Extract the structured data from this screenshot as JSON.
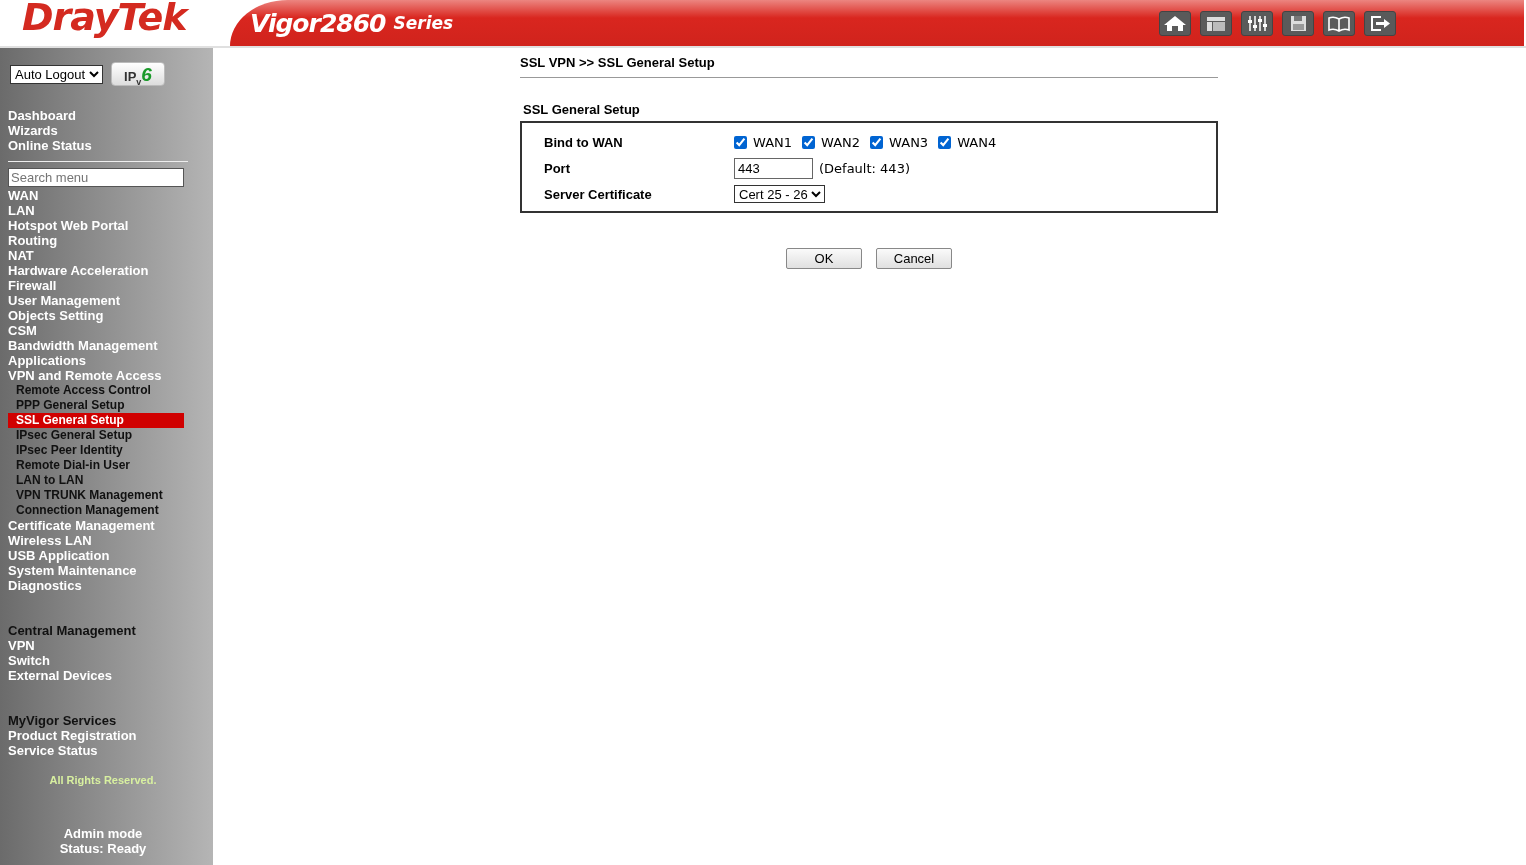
{
  "header": {
    "brand": "DrayTek",
    "model": "Vigor2860",
    "series": "Series"
  },
  "sidebar": {
    "auto_logout": {
      "value": "Auto Logout"
    },
    "ipv6_button": {
      "label": "IP$_{v}$**6**"
    },
    "top_links": [
      "Dashboard",
      "Wizards",
      "Online Status"
    ],
    "search": {
      "placeholder": "Search menu"
    },
    "menu": [
      {
        "label": "WAN"
      },
      {
        "label": "LAN"
      },
      {
        "label": "Hotspot Web Portal"
      },
      {
        "label": "Routing"
      },
      {
        "label": "NAT"
      },
      {
        "label": "Hardware Acceleration"
      },
      {
        "label": "Firewall"
      },
      {
        "label": "User Management"
      },
      {
        "label": "Objects Setting"
      },
      {
        "label": "CSM"
      },
      {
        "label": "Bandwidth Management"
      },
      {
        "label": "Applications"
      },
      {
        "label": "VPN and Remote Access",
        "children": [
          {
            "label": "Remote Access Control",
            "selected": false
          },
          {
            "label": "PPP General Setup",
            "selected": false
          },
          {
            "label": "SSL General Setup",
            "selected": true
          },
          {
            "label": "IPsec General Setup",
            "selected": false
          },
          {
            "label": "IPsec Peer Identity",
            "selected": false
          },
          {
            "label": "Remote Dial-in User",
            "selected": false
          },
          {
            "label": "LAN to LAN",
            "selected": false
          },
          {
            "label": "VPN TRUNK Management",
            "selected": false
          },
          {
            "label": "Connection Management",
            "selected": false
          }
        ]
      },
      {
        "label": "Certificate Management"
      },
      {
        "label": "Wireless LAN"
      },
      {
        "label": "USB Application"
      },
      {
        "label": "System Maintenance"
      },
      {
        "label": "Diagnostics"
      }
    ],
    "sections": [
      {
        "heading": "Central Management",
        "items": [
          "VPN",
          "Switch",
          "External Devices"
        ]
      },
      {
        "heading": "MyVigor Services",
        "items": [
          "Product Registration",
          "Service Status"
        ]
      }
    ],
    "copyright": "All Rights Reserved.",
    "mode": "Admin mode",
    "status": "Status: Ready"
  },
  "main": {
    "breadcrumb": "SSL VPN >> SSL General Setup",
    "section_title": "SSL General Setup",
    "fields": [
      {
        "kind": "checkboxes",
        "label": "Bind to WAN",
        "options": [
          {
            "label": "WAN1",
            "checked": true
          },
          {
            "label": "WAN2",
            "checked": true
          },
          {
            "label": "WAN3",
            "checked": true
          },
          {
            "label": "WAN4",
            "checked": true
          }
        ]
      },
      {
        "kind": "input",
        "label": "Port",
        "value": "443",
        "hint": "(Default: 443)"
      },
      {
        "kind": "select",
        "label": "Server Certificate",
        "value": "Cert 25 - 26"
      }
    ],
    "buttons": [
      "OK",
      "Cancel"
    ]
  }
}
